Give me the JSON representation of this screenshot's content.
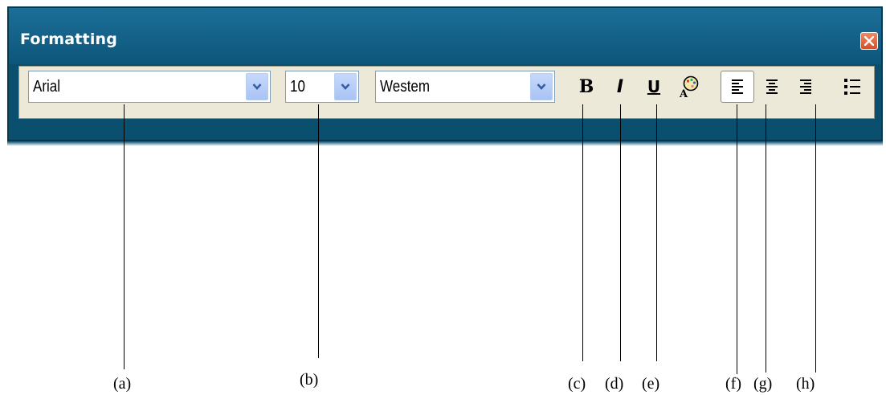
{
  "window": {
    "title": "Formatting",
    "close_icon": "close-x-icon",
    "title_bar_color": "#0d557a"
  },
  "toolbar": {
    "font_name": {
      "value": "Arial",
      "arrow_icon": "chevron-down-icon"
    },
    "font_size": {
      "value": "10",
      "arrow_icon": "chevron-down-icon"
    },
    "script": {
      "value": "Westem",
      "arrow_icon": "chevron-down-icon"
    },
    "bold_label": "B",
    "italic_label": "I",
    "underline_label": "U",
    "font_color_icon": "font-color-icon",
    "align_left_icon": "align-left-icon",
    "align_center_icon": "align-center-icon",
    "align_right_icon": "align-right-icon",
    "bullets_icon": "bullet-list-icon"
  },
  "callouts": {
    "a": "(a)",
    "b": "(b)",
    "c": "(c)",
    "d": "(d)",
    "e": "(e)",
    "f": "(f)",
    "g": "(g)",
    "h": "(h)"
  }
}
